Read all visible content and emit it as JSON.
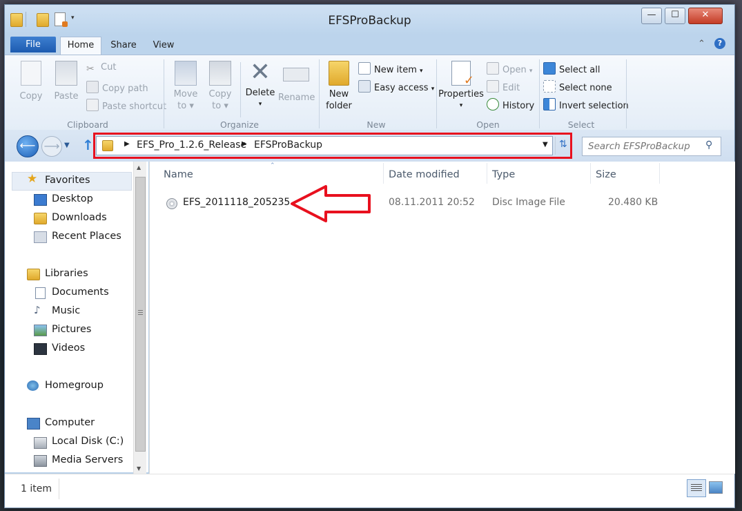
{
  "window": {
    "title": "EFSProBackup"
  },
  "caption_buttons": {
    "minimize": "—",
    "maximize": "☐",
    "close": "✕"
  },
  "tabs": {
    "file": "File",
    "home": "Home",
    "share": "Share",
    "view": "View"
  },
  "ribbon": {
    "clipboard": {
      "label": "Clipboard",
      "copy": "Copy",
      "paste": "Paste",
      "cut": "Cut",
      "copy_path": "Copy path",
      "paste_shortcut": "Paste shortcut"
    },
    "organize": {
      "label": "Organize",
      "move_to": "Move",
      "move_to_2": "to",
      "copy_to": "Copy",
      "copy_to_2": "to",
      "delete": "Delete",
      "rename": "Rename"
    },
    "new": {
      "label": "New",
      "new_folder": "New",
      "new_folder_2": "folder",
      "new_item": "New item",
      "easy_access": "Easy access"
    },
    "open": {
      "label": "Open",
      "properties": "Properties",
      "open": "Open",
      "edit": "Edit",
      "history": "History"
    },
    "select": {
      "label": "Select",
      "select_all": "Select all",
      "select_none": "Select none",
      "invert_selection": "Invert selection"
    }
  },
  "address": {
    "crumbs": [
      "EFS_Pro_1.2.6_Release",
      "EFSProBackup"
    ],
    "search_placeholder": "Search EFSProBackup"
  },
  "nav_pane": {
    "favorites": "Favorites",
    "desktop": "Desktop",
    "downloads": "Downloads",
    "recent_places": "Recent Places",
    "libraries": "Libraries",
    "documents": "Documents",
    "music": "Music",
    "pictures": "Pictures",
    "videos": "Videos",
    "homegroup": "Homegroup",
    "computer": "Computer",
    "local_disk": "Local Disk (C:)",
    "media_servers": "Media Servers"
  },
  "columns": {
    "name": "Name",
    "date_modified": "Date modified",
    "type": "Type",
    "size": "Size"
  },
  "files": [
    {
      "name": "EFS_2011118_205235",
      "date_modified": "08.11.2011 20:52",
      "type": "Disc Image File",
      "size": "20.480 KB"
    }
  ],
  "status": {
    "item_count": "1 item"
  },
  "colors": {
    "highlight": "#e8101e",
    "file_tab": "#1d5bb0"
  }
}
